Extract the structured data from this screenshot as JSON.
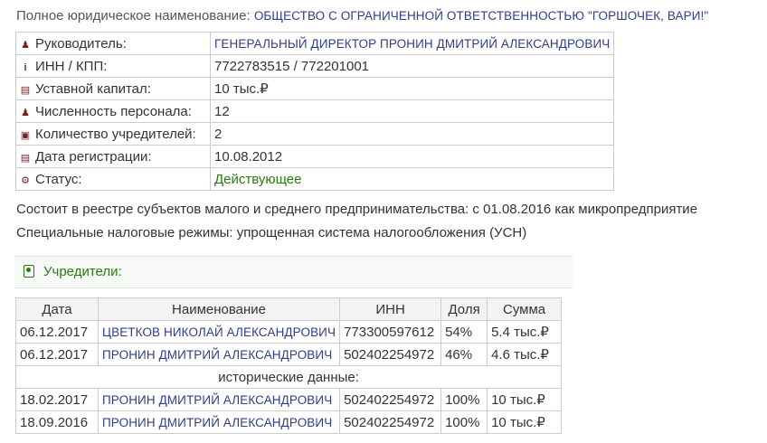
{
  "company": {
    "full_name_label": "Полное юридическое наименование:",
    "full_name": "ОБЩЕСТВО С ОГРАНИЧЕННОЙ ОТВЕТСТВЕННОСТЬЮ \"ГОРШОЧЕК, ВАРИ!\""
  },
  "info_rows": [
    {
      "icon": "person-icon",
      "label": "Руководитель:",
      "value": "ГЕНЕРАЛЬНЫЙ ДИРЕКТОР ПРОНИН ДМИТРИЙ АЛЕКСАНДРОВИЧ"
    },
    {
      "icon": "info-icon",
      "label": "ИНН / КПП:",
      "value": "7722783515 / 772201001"
    },
    {
      "icon": "money-icon",
      "label": "Уставной капитал:",
      "value": "10 тыс.₽"
    },
    {
      "icon": "people-icon",
      "label": "Численность персонала:",
      "value": "12"
    },
    {
      "icon": "contact-icon",
      "label": "Количество учредителей:",
      "value": "2"
    },
    {
      "icon": "card-icon",
      "label": "Дата регистрации:",
      "value": "10.08.2012"
    },
    {
      "icon": "gears-icon",
      "label": "Статус:",
      "value": "Действующее"
    }
  ],
  "smb_text": "Состоит в реестре субъектов малого и среднего предпринимательства: с 01.08.2016 как микропредприятие",
  "tax_text": "Специальные налоговые режимы: упрощенная система налогообложения (УСН)",
  "founders": {
    "title": "Учредители:",
    "columns": [
      "Дата",
      "Наименование",
      "ИНН",
      "Доля",
      "Сумма"
    ],
    "rows": [
      {
        "date": "06.12.2017",
        "name": "ЦВЕТКОВ НИКОЛАЙ АЛЕКСАНДРОВИЧ",
        "inn": "773300597612",
        "share": "54%",
        "sum": "5.4 тыс.₽"
      },
      {
        "date": "06.12.2017",
        "name": "ПРОНИН ДМИТРИЙ АЛЕКСАНДРОВИЧ",
        "inn": "502402254972",
        "share": "46%",
        "sum": "4.6 тыс.₽"
      }
    ],
    "history_label": "исторические данные:",
    "history_rows": [
      {
        "date": "18.02.2017",
        "name": "ПРОНИН ДМИТРИЙ АЛЕКСАНДРОВИЧ",
        "inn": "502402254972",
        "share": "100%",
        "sum": "10 тыс.₽"
      },
      {
        "date": "18.09.2016",
        "name": "ПРОНИН ДМИТРИЙ АЛЕКСАНДРОВИЧ",
        "inn": "502402254972",
        "share": "100%",
        "sum": "10 тыс.₽"
      }
    ]
  }
}
